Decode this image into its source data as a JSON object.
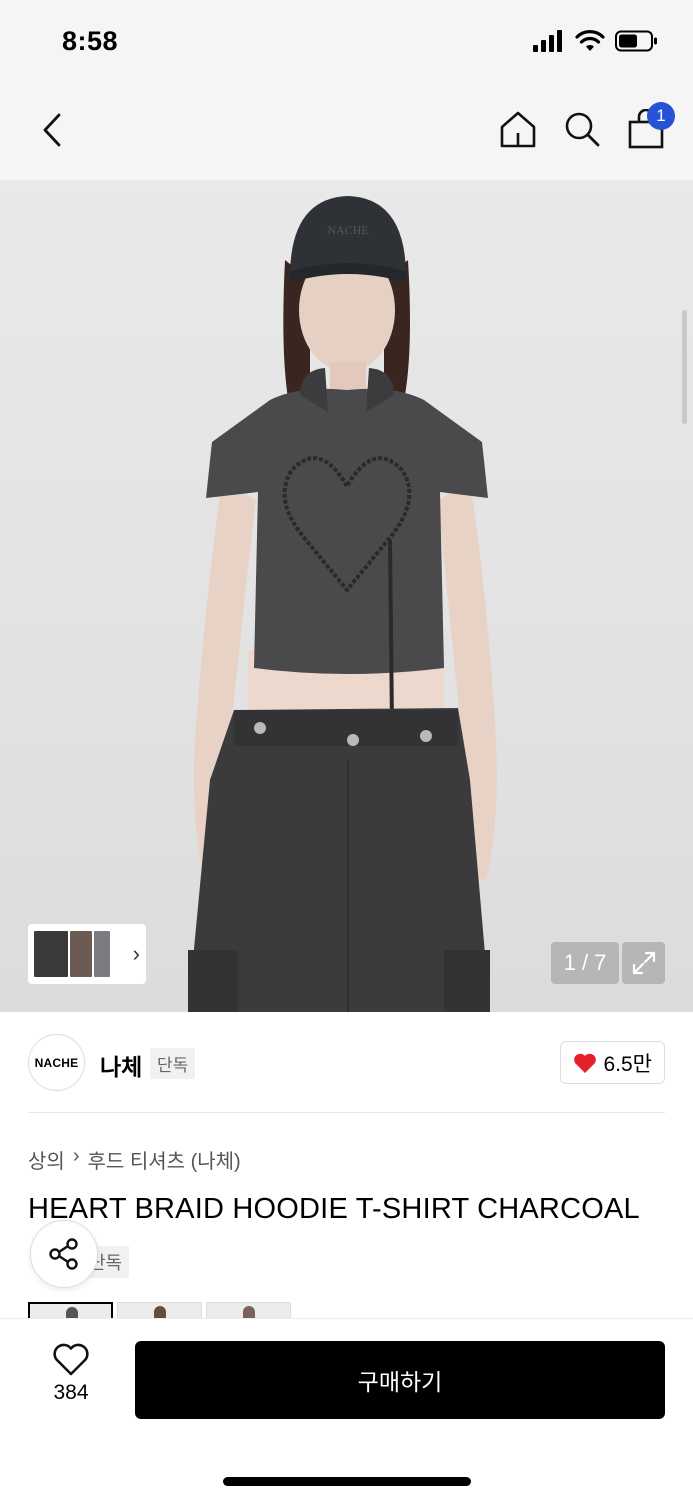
{
  "status_bar": {
    "time": "8:58"
  },
  "nav": {
    "cart_count": "1"
  },
  "gallery": {
    "counter": "1 / 7",
    "cap_text": "NACHE"
  },
  "brand": {
    "logo_text": "NACHE",
    "name": "나체",
    "tag": "단독",
    "likes": "6.5만"
  },
  "breadcrumb": {
    "category": "상의",
    "separator": "›",
    "subcategory": "후드 티셔츠 (나체)"
  },
  "product": {
    "title": "HEART BRAID HOODIE T-SHIRT CHARCOAL",
    "tag": "단독"
  },
  "bottom_bar": {
    "wish_count": "384",
    "buy_label": "구매하기"
  },
  "colors": {
    "accent_blue": "#2453d6",
    "like_red": "#e6202b",
    "garment": "#4a4a4c"
  },
  "icons": [
    "back-icon",
    "home-icon",
    "search-icon",
    "cart-icon",
    "expand-icon",
    "heart-icon",
    "share-icon",
    "chevron-right-icon"
  ]
}
